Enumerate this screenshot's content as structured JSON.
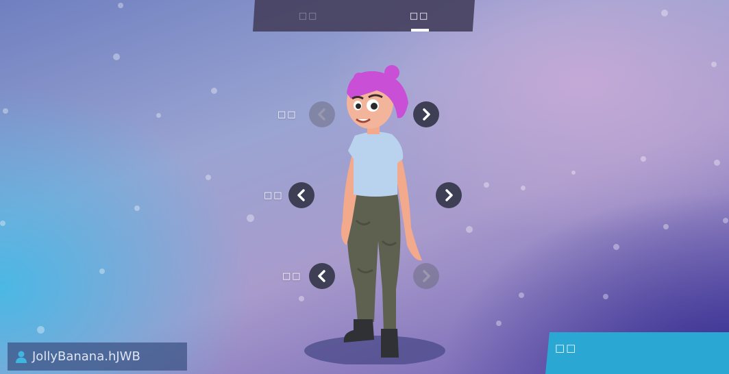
{
  "tabs": [
    {
      "label": "□□",
      "active": false
    },
    {
      "label": "□□",
      "active": true
    }
  ],
  "rows": [
    {
      "label": "□□",
      "prev_enabled": false,
      "next_enabled": true
    },
    {
      "label": "□□",
      "prev_enabled": true,
      "next_enabled": true
    },
    {
      "label": "□□",
      "prev_enabled": true,
      "next_enabled": false
    }
  ],
  "icons": {
    "prev": "chevron-left-icon",
    "next": "chevron-right-icon",
    "user": "user-icon"
  },
  "user": {
    "name": "JollyBanana.hJWB"
  },
  "confirm_button": {
    "label": "□□"
  },
  "colors": {
    "tab_bar": "#46415f",
    "arrow_button": "#3e3e55",
    "confirm_button": "#2aa7d3",
    "hair": "#c94fd6",
    "shirt": "#b9d3ef",
    "pants": "#5f6150"
  }
}
